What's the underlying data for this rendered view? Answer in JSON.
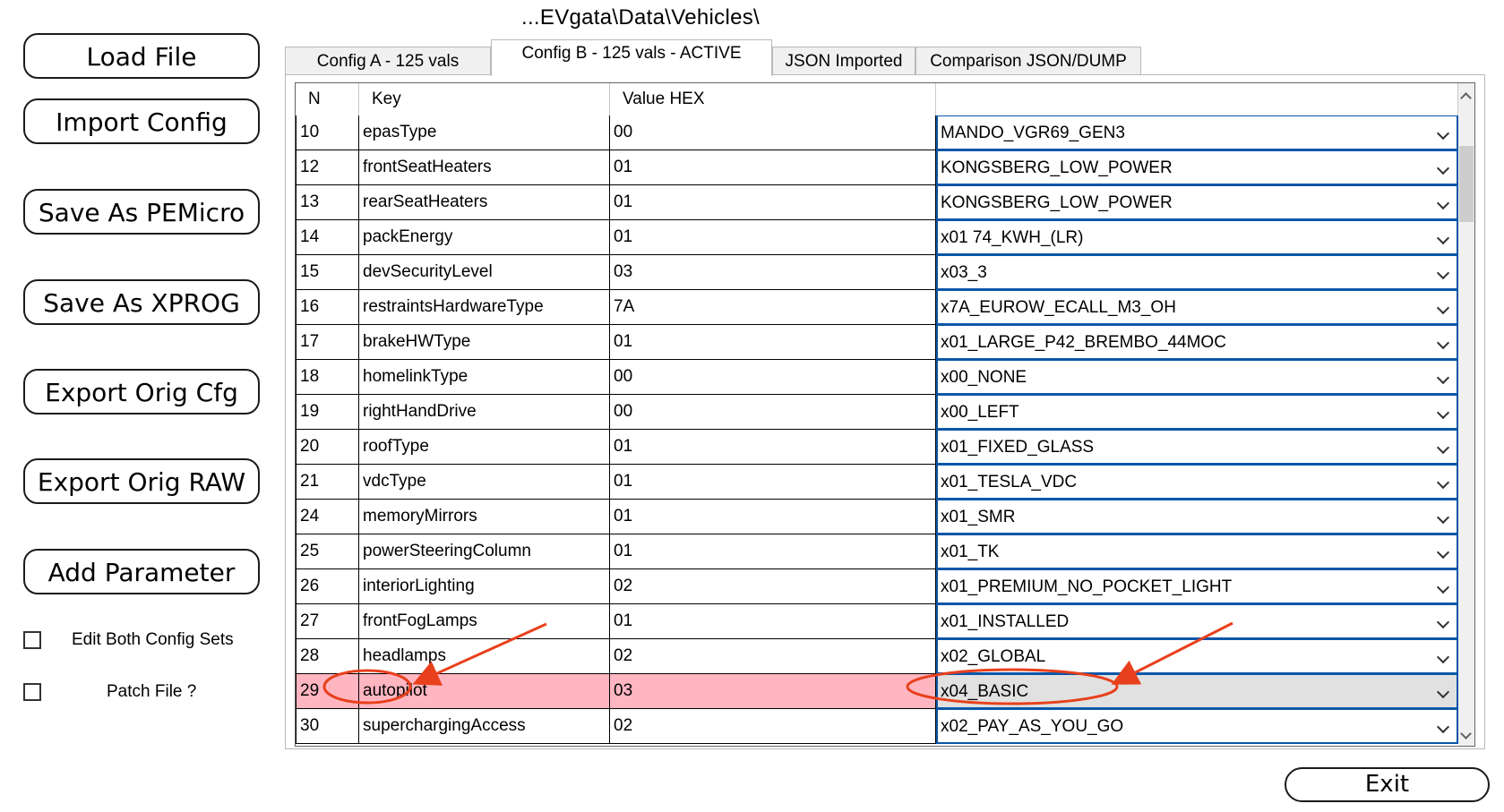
{
  "path_text": "...EVgata\\Data\\Vehicles\\",
  "left_buttons": [
    "Load File",
    "Import Config",
    "Save As PEMicro",
    "Save As XPROG",
    "Export Orig Cfg",
    "Export Orig RAW",
    "Add Parameter"
  ],
  "checkboxes": [
    {
      "label": "Edit Both Config Sets",
      "checked": false
    },
    {
      "label": "Patch File ?",
      "checked": false
    }
  ],
  "tabs": [
    "Config A - 125 vals",
    "Config B - 125 vals - ACTIVE",
    "JSON Imported",
    "Comparison JSON/DUMP"
  ],
  "active_tab": "Config B - 125 vals - ACTIVE",
  "table": {
    "headers": [
      "N",
      "Key",
      "Value HEX",
      ""
    ],
    "rows": [
      {
        "n": "10",
        "key": "epasType",
        "hex": "00",
        "value": "MANDO_VGR69_GEN3"
      },
      {
        "n": "12",
        "key": "frontSeatHeaters",
        "hex": "01",
        "value": "KONGSBERG_LOW_POWER"
      },
      {
        "n": "13",
        "key": "rearSeatHeaters",
        "hex": "01",
        "value": "KONGSBERG_LOW_POWER"
      },
      {
        "n": "14",
        "key": "packEnergy",
        "hex": "01",
        "value": "x01 74_KWH_(LR)"
      },
      {
        "n": "15",
        "key": "devSecurityLevel",
        "hex": "03",
        "value": "x03_3"
      },
      {
        "n": "16",
        "key": "restraintsHardwareType",
        "hex": "7A",
        "value": "x7A_EUROW_ECALL_M3_OH"
      },
      {
        "n": "17",
        "key": "brakeHWType",
        "hex": "01",
        "value": "x01_LARGE_P42_BREMBO_44MOC"
      },
      {
        "n": "18",
        "key": "homelinkType",
        "hex": "00",
        "value": "x00_NONE"
      },
      {
        "n": "19",
        "key": "rightHandDrive",
        "hex": "00",
        "value": "x00_LEFT"
      },
      {
        "n": "20",
        "key": "roofType",
        "hex": "01",
        "value": "x01_FIXED_GLASS"
      },
      {
        "n": "21",
        "key": "vdcType",
        "hex": "01",
        "value": "x01_TESLA_VDC"
      },
      {
        "n": "24",
        "key": "memoryMirrors",
        "hex": "01",
        "value": "x01_SMR"
      },
      {
        "n": "25",
        "key": "powerSteeringColumn",
        "hex": "01",
        "value": "x01_TK"
      },
      {
        "n": "26",
        "key": "interiorLighting",
        "hex": "02",
        "value": "x01_PREMIUM_NO_POCKET_LIGHT"
      },
      {
        "n": "27",
        "key": "frontFogLamps",
        "hex": "01",
        "value": "x01_INSTALLED"
      },
      {
        "n": "28",
        "key": "headlamps",
        "hex": "02",
        "value": "x02_GLOBAL"
      },
      {
        "n": "29",
        "key": "autopilot",
        "hex": "03",
        "value": "x04_BASIC",
        "highlighted": true
      },
      {
        "n": "30",
        "key": "superchargingAccess",
        "hex": "02",
        "value": "x02_PAY_AS_YOU_GO"
      }
    ]
  },
  "exit_label": "Exit",
  "colors": {
    "highlight_row": "#ffb6c1",
    "combo_border": "#0a56a8",
    "annotation": "#e8401c"
  }
}
